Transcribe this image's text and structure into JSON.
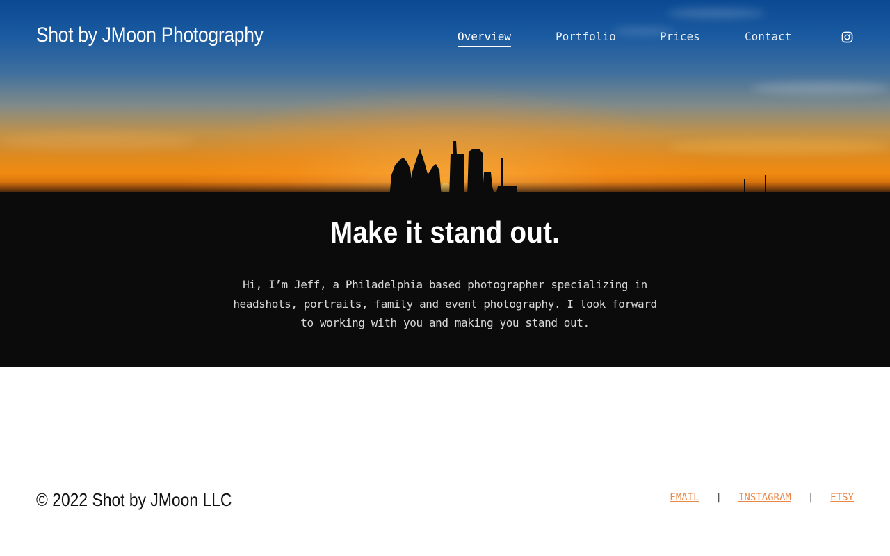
{
  "site": {
    "title": "Shot by JMoon Photography"
  },
  "nav": {
    "items": [
      {
        "label": "Overview",
        "active": true
      },
      {
        "label": "Portfolio",
        "active": false
      },
      {
        "label": "Prices",
        "active": false
      },
      {
        "label": "Contact",
        "active": false
      }
    ],
    "social_icon": "instagram-icon"
  },
  "hero": {
    "headline": "Make it stand out.",
    "intro": "Hi, I’m Jeff, a Philadelphia based photographer specializing in headshots, portraits, family and event photography. I look forward to working with you and making you stand out."
  },
  "footer": {
    "copyright": "© 2022 Shot by JMoon LLC",
    "links": [
      "EMAIL",
      "INSTAGRAM",
      "ETSY"
    ],
    "separator": "|"
  },
  "colors": {
    "hero_background": "#0b0b0b",
    "page_background": "#ffffff",
    "footer_link": "#e8894a",
    "nav_text": "#ffffff"
  }
}
